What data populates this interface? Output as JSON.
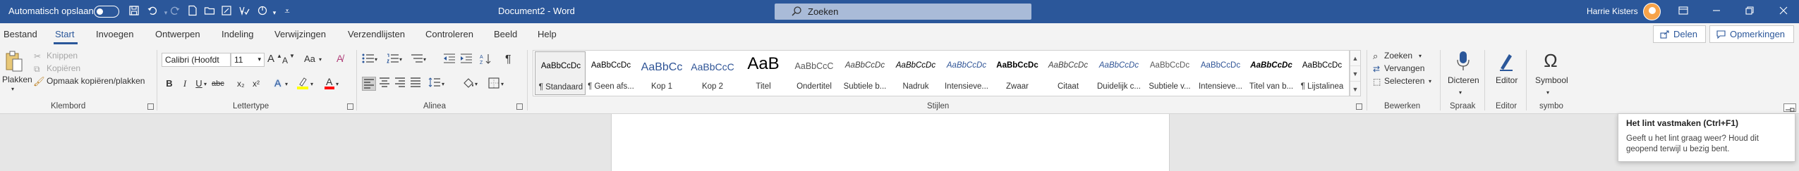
{
  "titlebar": {
    "autosave_label": "Automatisch opslaan",
    "document_title": "Document2  -  Word",
    "search_placeholder": "Zoeken",
    "user_name": "Harrie Kisters",
    "icons": [
      "save-icon",
      "undo-icon",
      "redo-icon",
      "new-document-icon",
      "open-folder-icon",
      "format-painter-icon",
      "spelling-icon",
      "customize-icon",
      "minimize-icon",
      "restore-icon",
      "close-icon"
    ]
  },
  "tabs": [
    "Bestand",
    "Start",
    "Invoegen",
    "Ontwerpen",
    "Indeling",
    "Verwijzingen",
    "Verzendlijsten",
    "Controleren",
    "Beeld",
    "Help"
  ],
  "active_tab": "Start",
  "share": {
    "share_label": "Delen",
    "comments_label": "Opmerkingen"
  },
  "clipboard": {
    "paste_label": "Plakken",
    "cut_label": "Knippen",
    "copy_label": "Kopiëren",
    "format_painter_label": "Opmaak kopiëren/plakken",
    "group_label": "Klembord"
  },
  "font": {
    "family": "Calibri (Hoofdt",
    "size": "11",
    "case_label": "Aa",
    "bold": "B",
    "italic": "I",
    "underline": "U",
    "strike": "abc",
    "subscript": "x₂",
    "superscript": "x²",
    "grow": "A",
    "shrink": "A",
    "effects": "A",
    "color": "A",
    "group_label": "Lettertype"
  },
  "paragraph": {
    "group_label": "Alinea",
    "pilcrow": "¶"
  },
  "styles": {
    "group_label": "Stijlen",
    "items": [
      {
        "preview": "AaBbCcDc",
        "name": "¶ Standaard",
        "size": "11.5px",
        "color": "#000000",
        "style": "normal",
        "weight": "normal"
      },
      {
        "preview": "AaBbCcDc",
        "name": "¶ Geen afs...",
        "size": "11.5px",
        "color": "#000000",
        "style": "normal",
        "weight": "normal"
      },
      {
        "preview": "AaBbCc",
        "name": "Kop 1",
        "size": "16px",
        "color": "#2f5496",
        "style": "normal",
        "weight": "normal"
      },
      {
        "preview": "AaBbCcC",
        "name": "Kop 2",
        "size": "14px",
        "color": "#2f5496",
        "style": "normal",
        "weight": "normal"
      },
      {
        "preview": "AaB",
        "name": "Titel",
        "size": "24px",
        "color": "#000000",
        "style": "normal",
        "weight": "normal"
      },
      {
        "preview": "AaBbCcC",
        "name": "Ondertitel",
        "size": "12.5px",
        "color": "#595959",
        "style": "normal",
        "weight": "normal"
      },
      {
        "preview": "AaBbCcDc",
        "name": "Subtiele b...",
        "size": "11.5px",
        "color": "#404040",
        "style": "italic",
        "weight": "normal"
      },
      {
        "preview": "AaBbCcDc",
        "name": "Nadruk",
        "size": "11.5px",
        "color": "#000000",
        "style": "italic",
        "weight": "normal"
      },
      {
        "preview": "AaBbCcDc",
        "name": "Intensieve...",
        "size": "11.5px",
        "color": "#2f5496",
        "style": "italic",
        "weight": "normal"
      },
      {
        "preview": "AaBbCcDc",
        "name": "Zwaar",
        "size": "11.5px",
        "color": "#000000",
        "style": "normal",
        "weight": "bold"
      },
      {
        "preview": "AaBbCcDc",
        "name": "Citaat",
        "size": "11.5px",
        "color": "#404040",
        "style": "italic",
        "weight": "normal"
      },
      {
        "preview": "AaBbCcDc",
        "name": "Duidelijk c...",
        "size": "11.5px",
        "color": "#2f5496",
        "style": "italic",
        "weight": "normal"
      },
      {
        "preview": "AaBbCcDc",
        "name": "Subtiele v...",
        "size": "11.5px",
        "color": "#5a5a5a",
        "style": "normal",
        "weight": "normal"
      },
      {
        "preview": "AaBbCcDc",
        "name": "Intensieve...",
        "size": "11.5px",
        "color": "#2f5496",
        "style": "normal",
        "weight": "normal"
      },
      {
        "preview": "AaBbCcDc",
        "name": "Titel van b...",
        "size": "11.5px",
        "color": "#000000",
        "style": "italic",
        "weight": "bold"
      },
      {
        "preview": "AaBbCcDc",
        "name": "¶ Lijstalinea",
        "size": "11.5px",
        "color": "#000000",
        "style": "normal",
        "weight": "normal"
      }
    ]
  },
  "editing": {
    "find_label": "Zoeken",
    "replace_label": "Vervangen",
    "select_label": "Selecteren",
    "group_label": "Bewerken"
  },
  "voice": {
    "dictate_label": "Dicteren",
    "group_label": "Spraak"
  },
  "editor": {
    "editor_label": "Editor",
    "group_label": "Editor"
  },
  "symbol": {
    "symbol_label": "Symbool",
    "group_label": "symbo",
    "omega": "Ω"
  },
  "tooltip": {
    "title": "Het lint vastmaken (Ctrl+F1)",
    "body": "Geeft u het lint graag weer? Houd dit geopend terwijl u bezig bent."
  },
  "colors": {
    "brand": "#2b579a",
    "highlight": "#ffff00",
    "font_color": "#ff0000"
  }
}
